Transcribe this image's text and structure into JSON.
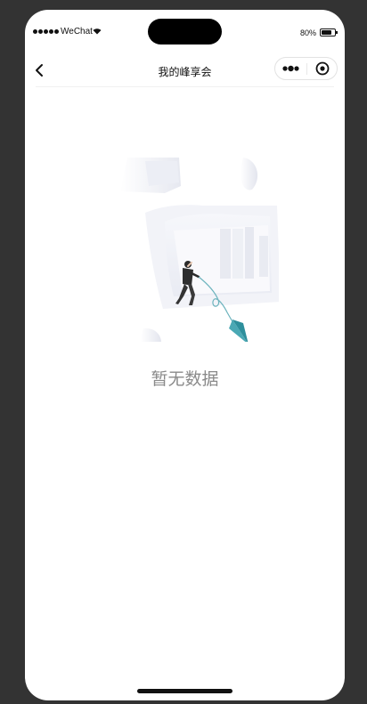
{
  "status_bar": {
    "carrier": "WeChat",
    "battery_percent": "80%",
    "battery_level": 0.8,
    "signal_icon": "signal-dots-icon",
    "wifi_icon": "wifi-icon"
  },
  "nav": {
    "title": "我的峰享会",
    "back_icon": "chevron-left-icon",
    "more_icon": "more-dots-icon",
    "close_icon": "target-circle-icon"
  },
  "empty_state": {
    "message": "暂无数据",
    "illustration": "empty-data-illustration"
  },
  "colors": {
    "accent_teal": "#4aa8b4",
    "text_muted": "#8a8a8a",
    "frame_bg": "#333333"
  }
}
